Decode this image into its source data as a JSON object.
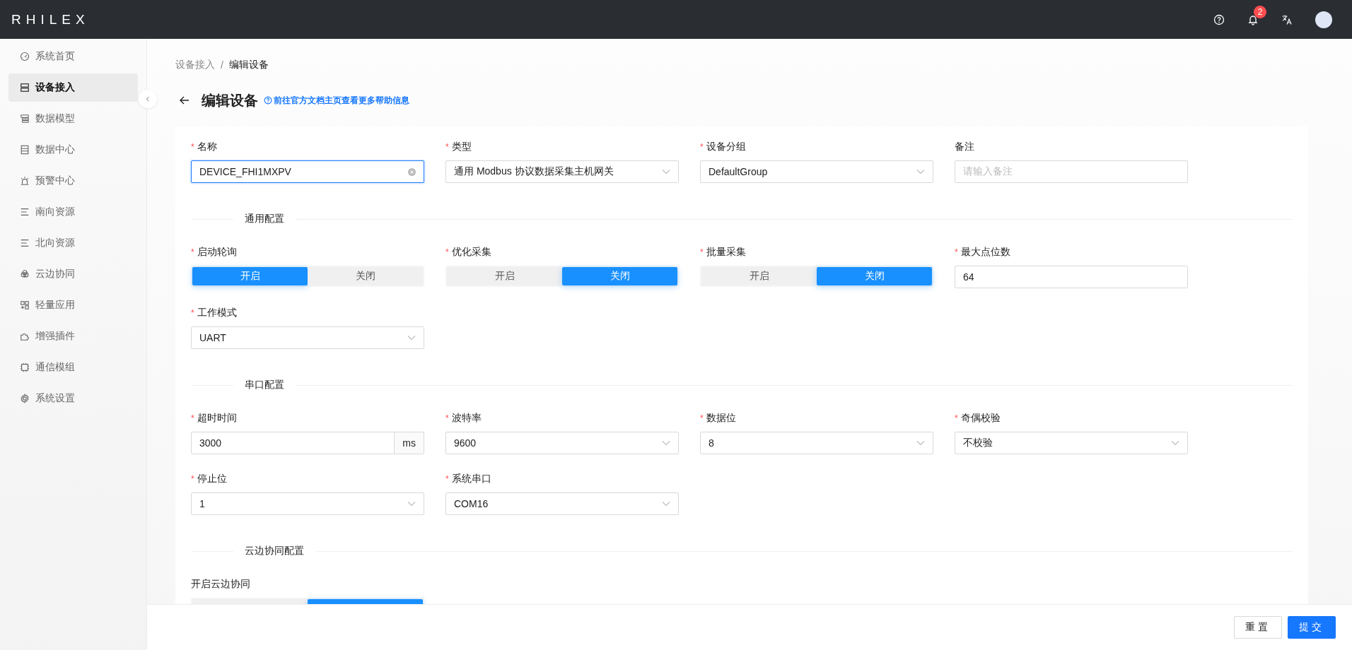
{
  "header": {
    "logo": "RHILEX",
    "notification_count": "2"
  },
  "sidebar": {
    "items": [
      {
        "label": "系统首页",
        "selected": false
      },
      {
        "label": "设备接入",
        "selected": true
      },
      {
        "label": "数据模型",
        "selected": false
      },
      {
        "label": "数据中心",
        "selected": false
      },
      {
        "label": "预警中心",
        "selected": false
      },
      {
        "label": "南向资源",
        "selected": false
      },
      {
        "label": "北向资源",
        "selected": false
      },
      {
        "label": "云边协同",
        "selected": false
      },
      {
        "label": "轻量应用",
        "selected": false
      },
      {
        "label": "增强插件",
        "selected": false
      },
      {
        "label": "通信模组",
        "selected": false
      },
      {
        "label": "系统设置",
        "selected": false
      }
    ]
  },
  "breadcrumb": {
    "items": [
      "设备接入",
      "编辑设备"
    ],
    "separator": "/"
  },
  "title": "编辑设备",
  "help_link": "前往官方文档主页查看更多帮助信息",
  "sections": [
    {
      "fields": [
        {
          "kind": "input",
          "label": "名称",
          "required_mark": "*",
          "value": "DEVICE_FHI1MXPV",
          "focused": true
        },
        {
          "kind": "select",
          "label": "类型",
          "required_mark": "*",
          "value": "通用 Modbus 协议数据采集主机网关"
        },
        {
          "kind": "select",
          "label": "设备分组",
          "required_mark": "*",
          "value": "DefaultGroup"
        },
        {
          "kind": "input",
          "label": "备注",
          "placeholder": "请输入备注"
        }
      ]
    },
    {
      "title": "通用配置",
      "fields": [
        {
          "kind": "toggle",
          "label": "启动轮询",
          "required_mark": "*",
          "options": [
            {
              "label": "开启",
              "selected": true
            },
            {
              "label": "关闭",
              "selected": false
            }
          ]
        },
        {
          "kind": "toggle",
          "label": "优化采集",
          "required_mark": "*",
          "options": [
            {
              "label": "开启",
              "selected": false
            },
            {
              "label": "关闭",
              "selected": true
            }
          ]
        },
        {
          "kind": "toggle",
          "label": "批量采集",
          "required_mark": "*",
          "options": [
            {
              "label": "开启",
              "selected": false
            },
            {
              "label": "关闭",
              "selected": true
            }
          ]
        },
        {
          "kind": "input",
          "label": "最大点位数",
          "required_mark": "*",
          "value": "64"
        },
        {
          "kind": "select",
          "label": "工作模式",
          "required_mark": "*",
          "value": "UART"
        }
      ]
    },
    {
      "title": "串口配置",
      "fields": [
        {
          "kind": "input",
          "label": "超时时间",
          "required_mark": "*",
          "value": "3000",
          "suffix": "ms"
        },
        {
          "kind": "select",
          "label": "波特率",
          "required_mark": "*",
          "value": "9600"
        },
        {
          "kind": "select",
          "label": "数据位",
          "required_mark": "*",
          "value": "8"
        },
        {
          "kind": "select",
          "label": "奇偶校验",
          "required_mark": "*",
          "value": "不校验"
        },
        {
          "kind": "select",
          "label": "停止位",
          "required_mark": "*",
          "value": "1"
        },
        {
          "kind": "select",
          "label": "系统串口",
          "required_mark": "*",
          "value": "COM16"
        }
      ]
    },
    {
      "title": "云边协同配置",
      "fields": [
        {
          "kind": "toggle",
          "label": "开启云边协同",
          "options": [
            {
              "selected": false
            },
            {
              "selected": true
            }
          ]
        }
      ]
    }
  ],
  "buttons": [
    {
      "label": "重置",
      "primary": false
    },
    {
      "label": "提交",
      "primary": true
    }
  ]
}
